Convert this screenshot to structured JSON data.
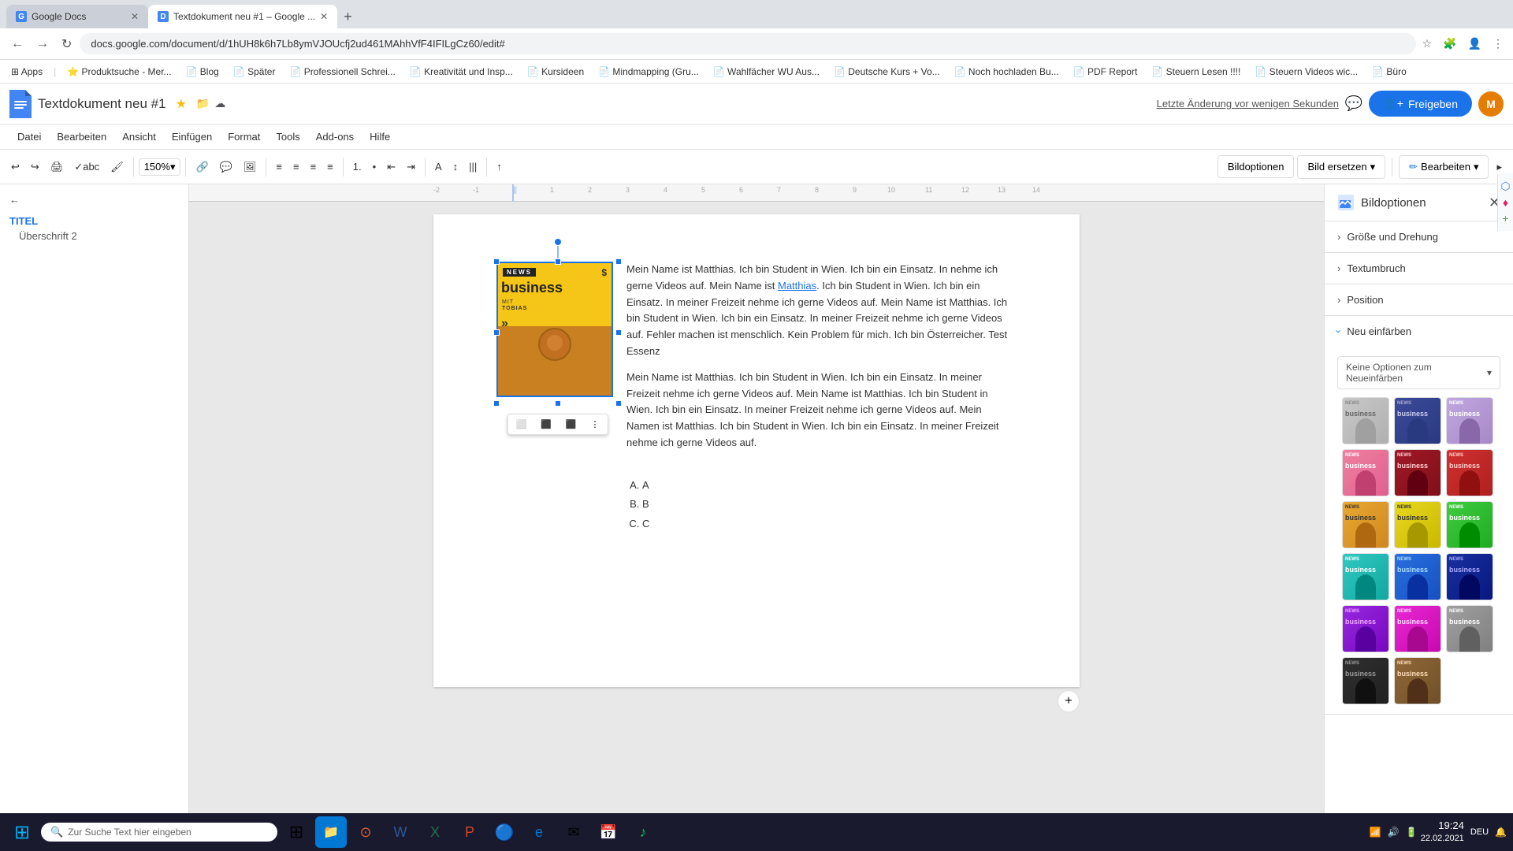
{
  "browser": {
    "tabs": [
      {
        "label": "Google Docs",
        "favicon": "G",
        "active": false
      },
      {
        "label": "Textdokument neu #1 – Google ...",
        "favicon": "D",
        "active": true
      },
      {
        "label": "+",
        "isNew": true
      }
    ],
    "address": "docs.google.com/document/d/1hUH8k6h7Lb8ymVJOUcfj2ud461MAhhVfF4IFILgCz60/edit#",
    "bookmarks": [
      {
        "label": "Apps",
        "icon": "grid"
      },
      {
        "label": "Produktsuche - Mer...",
        "icon": "star"
      },
      {
        "label": "Blog",
        "icon": "page"
      },
      {
        "label": "Später",
        "icon": "page"
      },
      {
        "label": "Professionell Schrei...",
        "icon": "page"
      },
      {
        "label": "Kreativität und Insp...",
        "icon": "page"
      },
      {
        "label": "Kursideen",
        "icon": "page"
      },
      {
        "label": "Mindmapping (Gru...",
        "icon": "page"
      },
      {
        "label": "Wahlfächer WU Aus...",
        "icon": "page"
      },
      {
        "label": "Deutsche Kurs + Vo...",
        "icon": "page"
      },
      {
        "label": "Noch hochladen Bu...",
        "icon": "page"
      },
      {
        "label": "PDF Report",
        "icon": "page"
      },
      {
        "label": "Steuern Lesen !!!!",
        "icon": "page"
      },
      {
        "label": "Steuern Videos wic...",
        "icon": "page"
      },
      {
        "label": "Büro",
        "icon": "page"
      }
    ]
  },
  "app": {
    "logo_color": "#4285f4",
    "doc_title": "Textdokument neu #1",
    "last_saved": "Letzte Änderung vor wenigen Sekunden",
    "share_label": "Freigeben",
    "comment_icon": "💬",
    "avatar_initials": "M"
  },
  "menu": {
    "items": [
      "Datei",
      "Bearbeiten",
      "Ansicht",
      "Einfügen",
      "Format",
      "Tools",
      "Add-ons",
      "Hilfe"
    ]
  },
  "toolbar": {
    "zoom": "150%",
    "bildoptionen": "Bildoptionen",
    "bild_ersetzen": "Bild ersetzen",
    "edit_mode": "Bearbeiten"
  },
  "outline": {
    "back_label": "←",
    "title": "TITEL",
    "heading2": "Überschrift 2"
  },
  "doc": {
    "paragraph1": "Mein Name ist Matthias. Ich bin Student in Wien. Ich bin ein Einsatz. In nehme ich gerne Videos auf. Mein Name ist Matthias. Ich bin Student in Wien. Ich bin ein Einsatz. In meiner Freizeit nehme ich gerne Videos auf. Mein Name ist Matthias. Ich bin Student in Wien. Ich bin ein Einsatz. In meiner Freizeit nehme ich gerne Videos auf. Fehler machen ist menschlich. Kein Problem für mich. Ich bin Österreicher. Test Essenz",
    "link_text": "Matthias",
    "paragraph2": "Mein Name ist Matthias. Ich bin Student in Wien. Ich bin ein Einsatz. In meiner Freizeit nehme ich gerne Videos auf. Mein Name ist Matthias. Ich bin Student in Wien. Ich bin ein Einsatz. In meiner Freizeit nehme ich gerne Videos auf. Mein Namen ist Matthias. Ich bin Student in Wien. Ich bin ein Einsatz. In meiner Freizeit nehme ich gerne Videos auf.",
    "list_items": [
      "A",
      "B",
      "C"
    ]
  },
  "image": {
    "news_label": "NEWS",
    "dollar_sign": "$",
    "business_text": "business",
    "mit_text": "MIT",
    "tobias_text": "TOBIAS"
  },
  "bildoptionen_panel": {
    "title": "Bildoptionen",
    "sections": [
      {
        "label": "Größe und Drehung",
        "expanded": false
      },
      {
        "label": "Textumbruch",
        "expanded": false
      },
      {
        "label": "Position",
        "expanded": false
      },
      {
        "label": "Neu einfärben",
        "expanded": true
      }
    ],
    "dropdown_label": "Keine Optionen zum Neueinfärben",
    "swatches": [
      {
        "color": "#c8c8c8",
        "bg": "#b0b0b0",
        "person": "#808080"
      },
      {
        "color": "#3a4a9a",
        "bg": "#2a3a80",
        "person": "#1a2a60"
      },
      {
        "color": "#c0a8e0",
        "bg": "#a888c8",
        "person": "#8868a8"
      },
      {
        "color": "#f090b0",
        "bg": "#e06090",
        "person": "#c04070"
      },
      {
        "color": "#a01828",
        "bg": "#801018",
        "person": "#600010"
      },
      {
        "color": "#d03030",
        "bg": "#b02020",
        "person": "#901010"
      },
      {
        "color": "#e8a830",
        "bg": "#d08820",
        "person": "#b06810"
      },
      {
        "color": "#e8d820",
        "bg": "#c8b800",
        "person": "#a89800"
      },
      {
        "color": "#40cc40",
        "bg": "#20ac20",
        "person": "#008c00"
      },
      {
        "color": "#30c8c0",
        "bg": "#10a8a0",
        "person": "#008880"
      },
      {
        "color": "#2870e0",
        "bg": "#1850c0",
        "person": "#0830a0"
      },
      {
        "color": "#1830a0",
        "bg": "#081880",
        "person": "#000860"
      },
      {
        "color": "#9828e0",
        "bg": "#7808c0",
        "person": "#5800a0"
      },
      {
        "color": "#e828d0",
        "bg": "#c808b0",
        "person": "#a80890"
      },
      {
        "color": "#a0a0a0",
        "bg": "#808080",
        "person": "#606060"
      },
      {
        "color": "#303030",
        "bg": "#202020",
        "person": "#101010"
      },
      {
        "color": "#906838",
        "bg": "#705028",
        "person": "#503018"
      },
      {
        "color": "#706858",
        "bg": "#504840",
        "person": "#302820"
      }
    ]
  },
  "taskbar": {
    "search_placeholder": "Zur Suche Text hier eingeben",
    "time": "19:24",
    "date": "22.02.2021",
    "language": "DEU"
  },
  "float_toolbar": {
    "btn1": "⬜",
    "btn2": "⬛",
    "btn3": "⬛",
    "more": "⋮"
  }
}
